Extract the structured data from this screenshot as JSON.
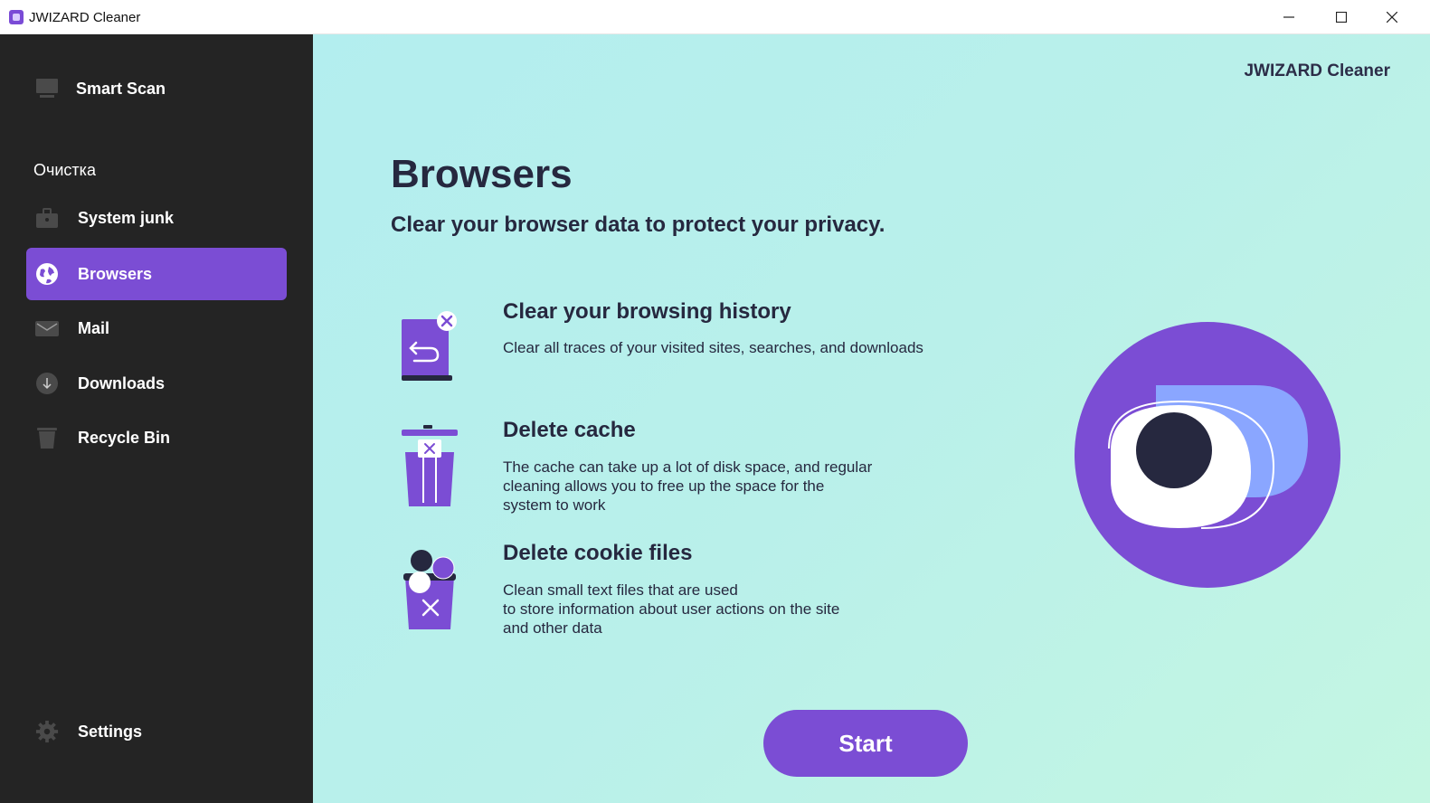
{
  "window": {
    "title": "JWIZARD Cleaner",
    "controls": [
      "minimize",
      "maximize",
      "close"
    ]
  },
  "sidebar": {
    "smart_scan": {
      "label": "Smart Scan",
      "icon": "monitor-icon"
    },
    "section_label": "Очистка",
    "items": [
      {
        "label": "System junk",
        "icon": "briefcase-icon",
        "active": false
      },
      {
        "label": "Browsers",
        "icon": "globe-icon",
        "active": true
      },
      {
        "label": "Mail",
        "icon": "envelope-icon",
        "active": false
      },
      {
        "label": "Downloads",
        "icon": "download-icon",
        "active": false
      },
      {
        "label": "Recycle Bin",
        "icon": "trash-icon",
        "active": false
      }
    ],
    "settings": {
      "label": "Settings",
      "icon": "gear-icon"
    }
  },
  "main": {
    "brand": "JWIZARD Cleaner",
    "title": "Browsers",
    "subtitle": "Clear your browser data to protect your privacy.",
    "features": [
      {
        "title": "Clear your browsing history",
        "description": "Clear all traces of your visited sites, searches, and downloads",
        "icon": "history-book-icon"
      },
      {
        "title": "Delete cache",
        "description": "The cache can take up a lot of disk space, and regular\ncleaning allows you to free up the space for the\nsystem to work",
        "icon": "cache-bin-icon"
      },
      {
        "title": "Delete cookie files",
        "description": "Clean small text files that are used\nto store information about user actions on the site\nand other data",
        "icon": "cookies-bin-icon"
      }
    ],
    "start_label": "Start",
    "illustration": "privacy-eye-icon"
  },
  "colors": {
    "accent": "#7b4dd4",
    "sidebar_bg": "#242424",
    "text_dark": "#26283f",
    "main_bg": "#b9f0ea"
  }
}
